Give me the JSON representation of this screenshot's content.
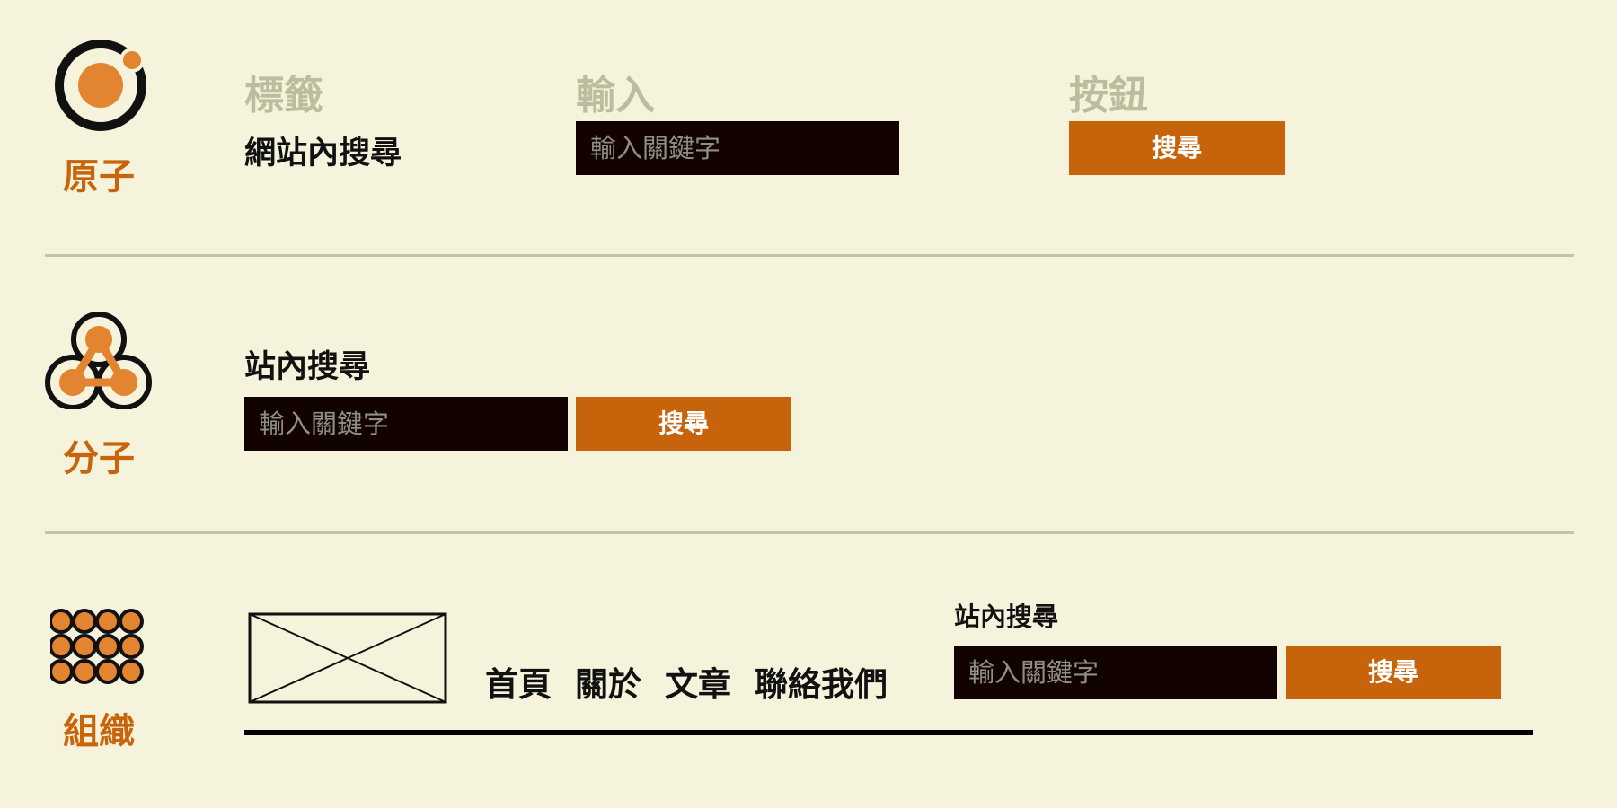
{
  "levels": {
    "atom": "原子",
    "molecule": "分子",
    "organism": "組織"
  },
  "columns": {
    "label": "標籤",
    "input": "輸入",
    "button": "按鈕"
  },
  "atom_row": {
    "label_text": "網站內搜尋",
    "input_placeholder": "輸入關鍵字",
    "button_label": "搜尋"
  },
  "molecule_row": {
    "label_text": "站內搜尋",
    "input_placeholder": "輸入關鍵字",
    "button_label": "搜尋"
  },
  "organism_row": {
    "nav_items": [
      "首頁",
      "關於",
      "文章",
      "聯絡我們"
    ],
    "search_label": "站內搜尋",
    "input_placeholder": "輸入關鍵字",
    "button_label": "搜尋"
  },
  "colors": {
    "background": "#f5f3db",
    "accent": "#c8650c",
    "field": "#120200",
    "muted": "#bdbc9f"
  }
}
